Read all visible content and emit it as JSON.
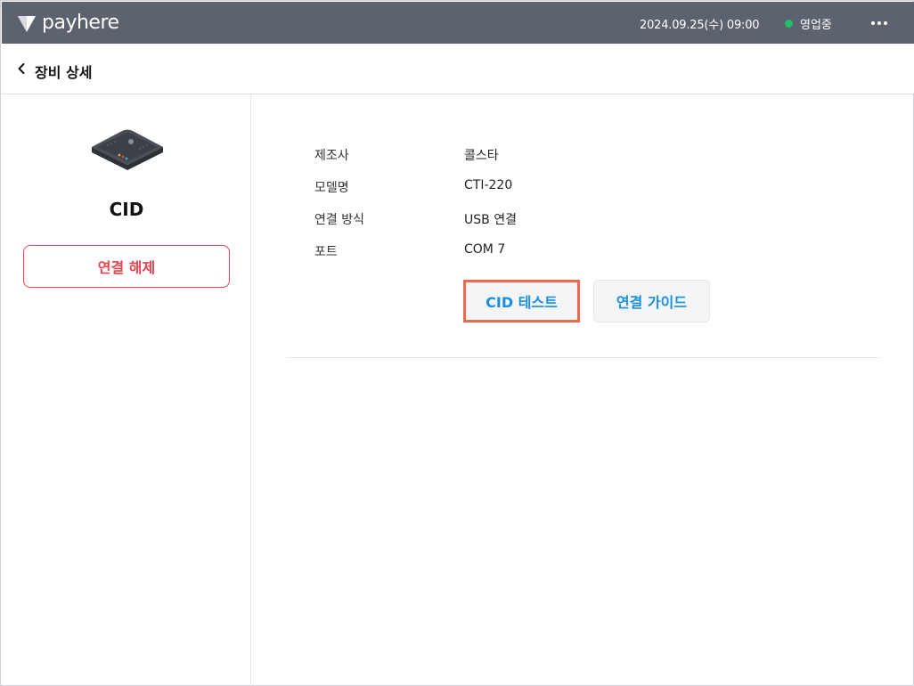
{
  "topbar": {
    "brand": "payhere",
    "datetime": "2024.09.25(수) 09:00",
    "status_label": "영업중",
    "status_color": "#21c16b",
    "more_icon": "more-horizontal-icon"
  },
  "header": {
    "back_icon": "chevron-left-icon",
    "title": "장비 상세"
  },
  "device": {
    "name": "CID",
    "disconnect_label": "연결 해제"
  },
  "details": [
    {
      "label": "제조사",
      "value": "콜스타"
    },
    {
      "label": "모델명",
      "value": "CTI-220"
    },
    {
      "label": "연결 방식",
      "value": "USB 연결"
    },
    {
      "label": "포트",
      "value": "COM 7"
    }
  ],
  "actions": {
    "test_label": "CID 테스트",
    "guide_label": "연결 가이드"
  },
  "colors": {
    "topbar_bg": "#5c636f",
    "accent_blue": "#1a8fde",
    "danger_red": "#e8434f",
    "highlight": "#ea6a52"
  }
}
